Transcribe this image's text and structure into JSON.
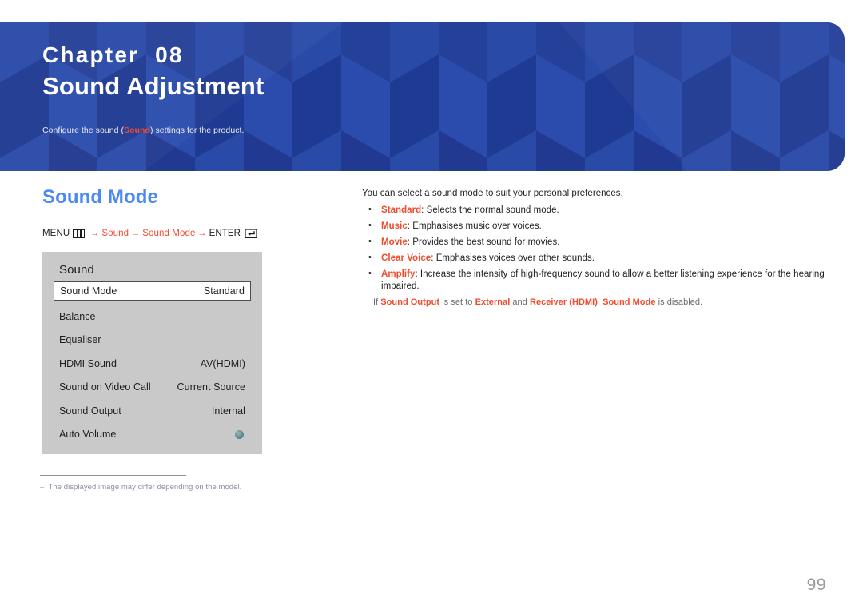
{
  "banner": {
    "chapter_label": "Chapter  08",
    "chapter_title": "Sound Adjustment",
    "subtitle_pre": "Configure the sound (",
    "subtitle_highlight": "Sound",
    "subtitle_post": ") settings for the product.",
    "bg_color": "#25409a",
    "highlight_color": "#f04b2d"
  },
  "section": {
    "heading": "Sound Mode",
    "heading_color": "#4a8af0"
  },
  "menu_path": {
    "menu_label": "MENU",
    "menu_icon": "menu-grid-icon",
    "arrow": "→",
    "step1": "Sound",
    "step2": "Sound Mode",
    "enter_label": "ENTER",
    "enter_icon": "enter-return-icon"
  },
  "osd": {
    "title": "Sound",
    "rows": [
      {
        "label": "Sound Mode",
        "value": "Standard",
        "selected": true,
        "type": "value"
      },
      {
        "label": "Balance",
        "value": "",
        "selected": false,
        "type": "value"
      },
      {
        "label": "Equaliser",
        "value": "",
        "selected": false,
        "type": "value"
      },
      {
        "label": "HDMI Sound",
        "value": "AV(HDMI)",
        "selected": false,
        "type": "value"
      },
      {
        "label": "Sound on Video Call",
        "value": "Current Source",
        "selected": false,
        "type": "value"
      },
      {
        "label": "Sound Output",
        "value": "Internal",
        "selected": false,
        "type": "value"
      },
      {
        "label": "Auto Volume",
        "value": "",
        "selected": false,
        "type": "toggle"
      }
    ],
    "panel_bg": "#c9c9c9"
  },
  "panel_footnote": {
    "text": "–  The displayed image may differ depending on the model."
  },
  "content": {
    "intro": "You can select a sound mode to suit your personal preferences.",
    "bullets": [
      {
        "term": "Standard",
        "rest": ": Selects the normal sound mode."
      },
      {
        "term": "Music",
        "rest": ": Emphasises music over voices."
      },
      {
        "term": "Movie",
        "rest": ": Provides the best sound for movies."
      },
      {
        "term": "Clear Voice",
        "rest": ": Emphasises voices over other sounds."
      },
      {
        "term": "Amplify",
        "rest": ": Increase the intensity of high-frequency sound to allow a better listening experience for the hearing impaired."
      }
    ],
    "note": {
      "p1": "If ",
      "t1": "Sound Output",
      "p2": " is set to ",
      "t2": "External",
      "p3": " and ",
      "t3": "Receiver (HDMI)",
      "p4": ", ",
      "t4": "Sound Mode",
      "p5": " is disabled."
    }
  },
  "page_number": "99"
}
